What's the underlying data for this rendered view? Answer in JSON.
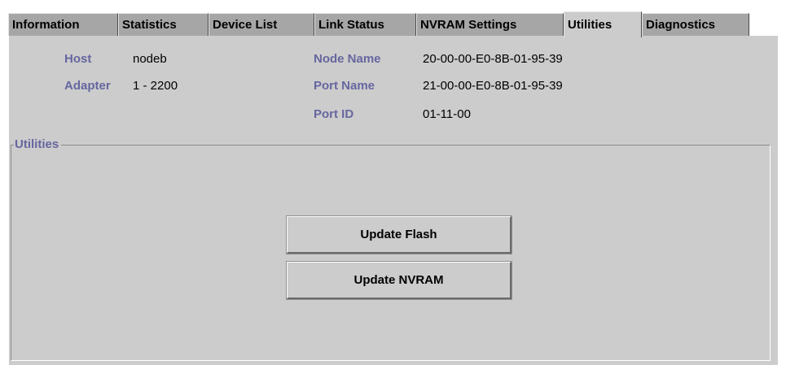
{
  "tabs": [
    {
      "label": "Information",
      "active": false
    },
    {
      "label": "Statistics",
      "active": false
    },
    {
      "label": "Device List",
      "active": false
    },
    {
      "label": "Link Status",
      "active": false
    },
    {
      "label": "NVRAM Settings",
      "active": false
    },
    {
      "label": "Utilities",
      "active": true
    },
    {
      "label": "Diagnostics",
      "active": false
    }
  ],
  "info": {
    "host_label": "Host",
    "host_value": "nodeb",
    "adapter_label": "Adapter",
    "adapter_value": "1 - 2200",
    "node_name_label": "Node Name",
    "node_name_value": "20-00-00-E0-8B-01-95-39",
    "port_name_label": "Port Name",
    "port_name_value": "21-00-00-E0-8B-01-95-39",
    "port_id_label": "Port ID",
    "port_id_value": "01-11-00"
  },
  "utilities": {
    "group_title": "Utilities",
    "update_flash_label": "Update Flash",
    "update_nvram_label": "Update NVRAM"
  },
  "colors": {
    "panel_bg": "#cccccc",
    "tab_inactive_bg": "#a6a6a6",
    "label_color": "#6666a0"
  }
}
